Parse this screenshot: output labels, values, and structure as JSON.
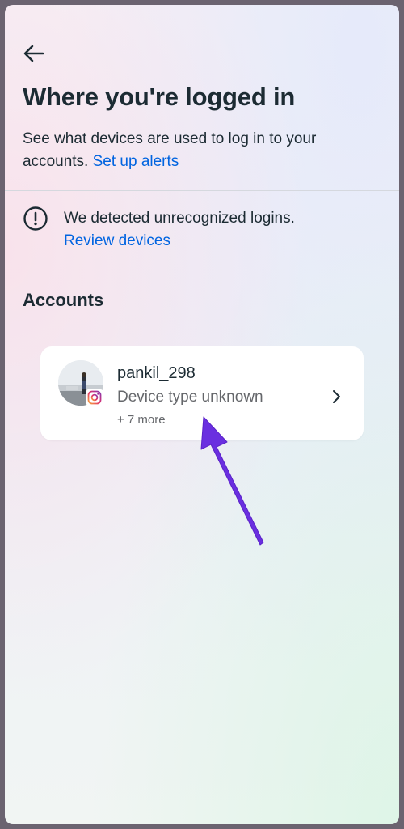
{
  "header": {
    "back_icon": "arrow-left-icon",
    "title": "Where you're logged in",
    "subtitle_text": "See what devices are used to log in to your accounts.",
    "subtitle_link": "Set up alerts"
  },
  "alert": {
    "icon": "exclamation-circle-icon",
    "message": "We detected unrecognized logins.",
    "link": "Review devices"
  },
  "accounts": {
    "section_title": "Accounts",
    "items": [
      {
        "username": "pankil_298",
        "device": "Device type unknown",
        "more": "+ 7 more",
        "platform_icon": "instagram-icon",
        "chevron_icon": "chevron-right-icon"
      }
    ]
  },
  "annotation": {
    "arrow_icon": "annotation-arrow-icon",
    "arrow_color": "#6a2fe0"
  },
  "colors": {
    "link": "#0064e0",
    "text": "#1c2b33",
    "secondary_text": "#65676b",
    "card": "#ffffff"
  }
}
